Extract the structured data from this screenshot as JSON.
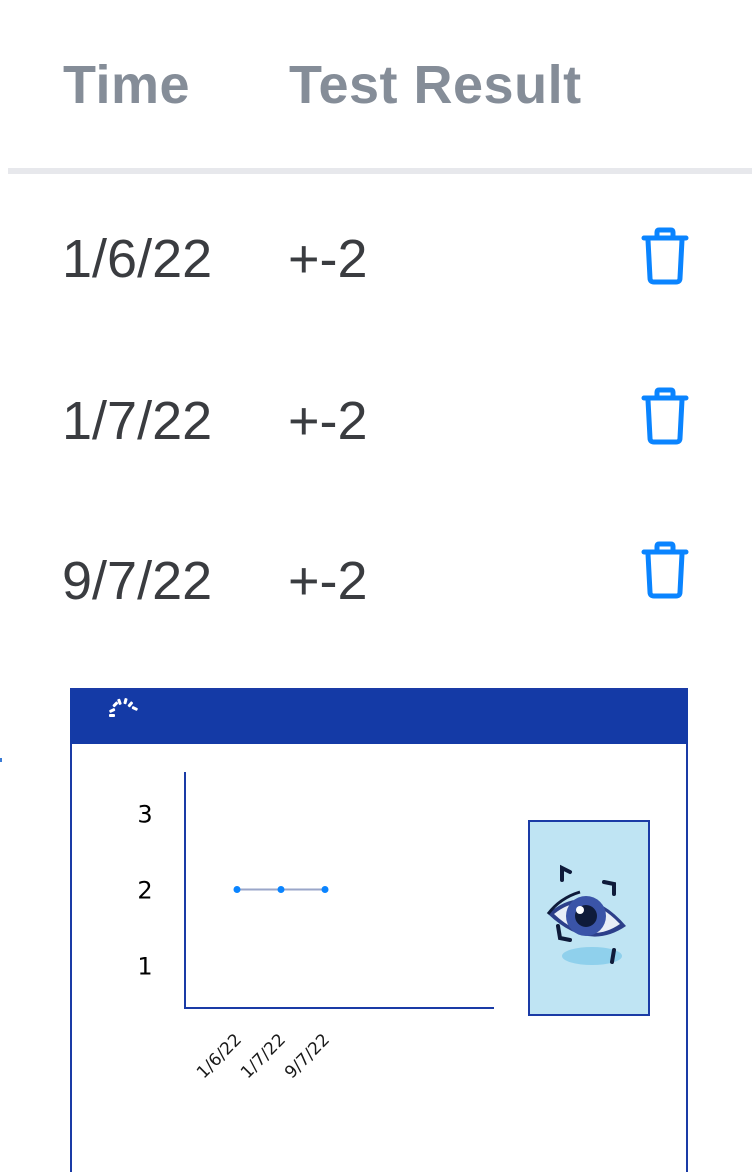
{
  "header": {
    "time_label": "Time",
    "result_label": "Test Result"
  },
  "rows": [
    {
      "time": "1/6/22",
      "result": "+-2"
    },
    {
      "time": "1/7/22",
      "result": "+-2"
    },
    {
      "time": "9/7/22",
      "result": "+-2"
    }
  ],
  "icons": {
    "delete": "trash-icon",
    "gauge": "gauge-icon",
    "eye_scan": "eye-scan-icon"
  },
  "colors": {
    "accent": "#0a84ff",
    "panel_border": "#1a3ba6",
    "panel_bar": "#143aa6",
    "header_text": "#858d98",
    "eye_card_bg": "#bfe4f3"
  },
  "chart_data": {
    "type": "line",
    "categories": [
      "1/6/22",
      "1/7/22",
      "9/7/22"
    ],
    "series": [
      {
        "values": [
          2,
          2,
          2
        ]
      }
    ],
    "yticks": [
      "1",
      "2",
      "3"
    ],
    "ylim": [
      0,
      3.3
    ],
    "grid": false,
    "title": "",
    "xlabel": "",
    "ylabel": ""
  }
}
